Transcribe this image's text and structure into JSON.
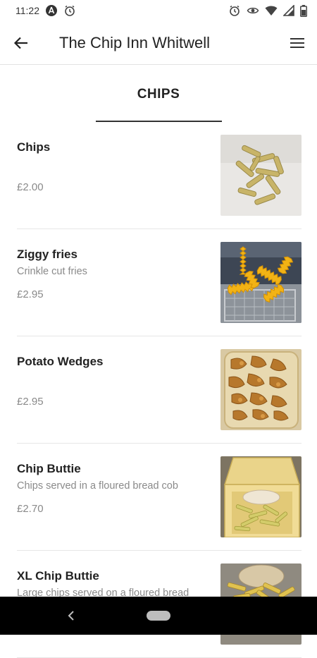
{
  "status_bar": {
    "time": "11:22"
  },
  "app_bar": {
    "title": "The Chip Inn Whitwell"
  },
  "category": {
    "title": "CHIPS"
  },
  "items": [
    {
      "name": "Chips",
      "description": "",
      "price": "£2.00",
      "photo_icon": "chips-photo"
    },
    {
      "name": "Ziggy fries",
      "description": "Crinkle cut fries",
      "price": "£2.95",
      "photo_icon": "crinkle-fries-photo"
    },
    {
      "name": "Potato Wedges",
      "description": "",
      "price": "£2.95",
      "photo_icon": "potato-wedges-photo"
    },
    {
      "name": "Chip Buttie",
      "description": "Chips served in a floured bread cob",
      "price": "£2.70",
      "photo_icon": "chip-buttie-photo"
    },
    {
      "name": "XL Chip Buttie",
      "description": "Large chips served on a floured bread",
      "price": "",
      "photo_icon": "xl-chip-buttie-photo"
    }
  ],
  "colors": {
    "text_primary": "#222222",
    "text_secondary": "#8a8a8a",
    "divider": "#e6e6e6",
    "nav_bar": "#000000"
  }
}
